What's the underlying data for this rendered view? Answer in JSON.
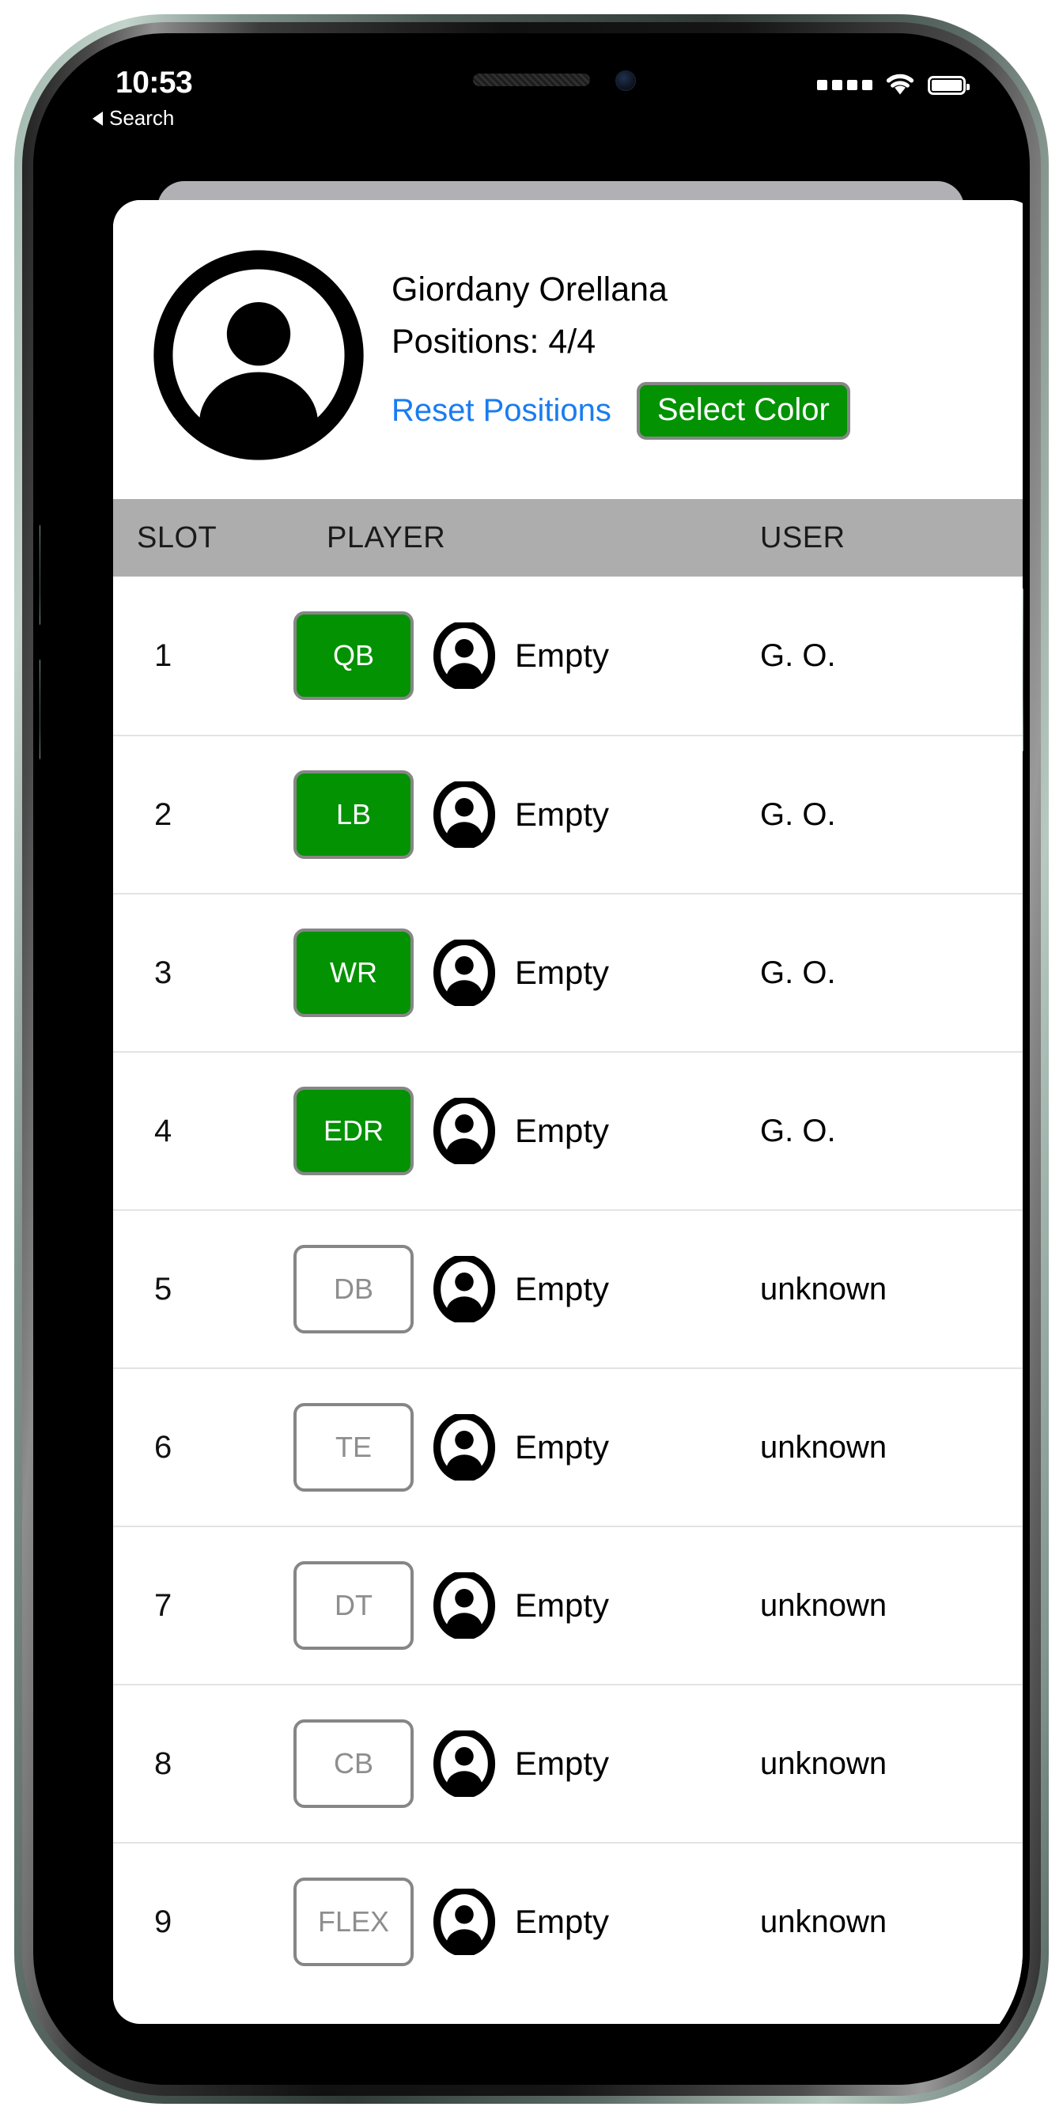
{
  "status_bar": {
    "time": "10:53",
    "back_label": "Search",
    "signal_dots": 4,
    "wifi_icon": "wifi-icon",
    "battery_level_pct": 100
  },
  "profile": {
    "avatar_icon": "person-avatar-icon",
    "name": "Giordany Orellana",
    "positions_label": "Positions: 4/4",
    "reset_button": "Reset Positions",
    "select_color_button": "Select Color",
    "accent_blue": "#1a7cf0",
    "accent_green": "#029202",
    "badge_border": "#868686"
  },
  "table": {
    "header_bg": "#adadad",
    "columns": [
      "SLOT",
      "PLAYER",
      "USER"
    ],
    "rows": [
      {
        "slot": "1",
        "position": "QB",
        "active": true,
        "avatar_icon": "person-avatar-icon",
        "player": "Empty",
        "user": "G. O."
      },
      {
        "slot": "2",
        "position": "LB",
        "active": true,
        "avatar_icon": "person-avatar-icon",
        "player": "Empty",
        "user": "G. O."
      },
      {
        "slot": "3",
        "position": "WR",
        "active": true,
        "avatar_icon": "person-avatar-icon",
        "player": "Empty",
        "user": "G. O."
      },
      {
        "slot": "4",
        "position": "EDR",
        "active": true,
        "avatar_icon": "person-avatar-icon",
        "player": "Empty",
        "user": "G. O."
      },
      {
        "slot": "5",
        "position": "DB",
        "active": false,
        "avatar_icon": "person-avatar-icon",
        "player": "Empty",
        "user": "unknown"
      },
      {
        "slot": "6",
        "position": "TE",
        "active": false,
        "avatar_icon": "person-avatar-icon",
        "player": "Empty",
        "user": "unknown"
      },
      {
        "slot": "7",
        "position": "DT",
        "active": false,
        "avatar_icon": "person-avatar-icon",
        "player": "Empty",
        "user": "unknown"
      },
      {
        "slot": "8",
        "position": "CB",
        "active": false,
        "avatar_icon": "person-avatar-icon",
        "player": "Empty",
        "user": "unknown"
      },
      {
        "slot": "9",
        "position": "FLEX",
        "active": false,
        "avatar_icon": "person-avatar-icon",
        "player": "Empty",
        "user": "unknown"
      }
    ]
  }
}
